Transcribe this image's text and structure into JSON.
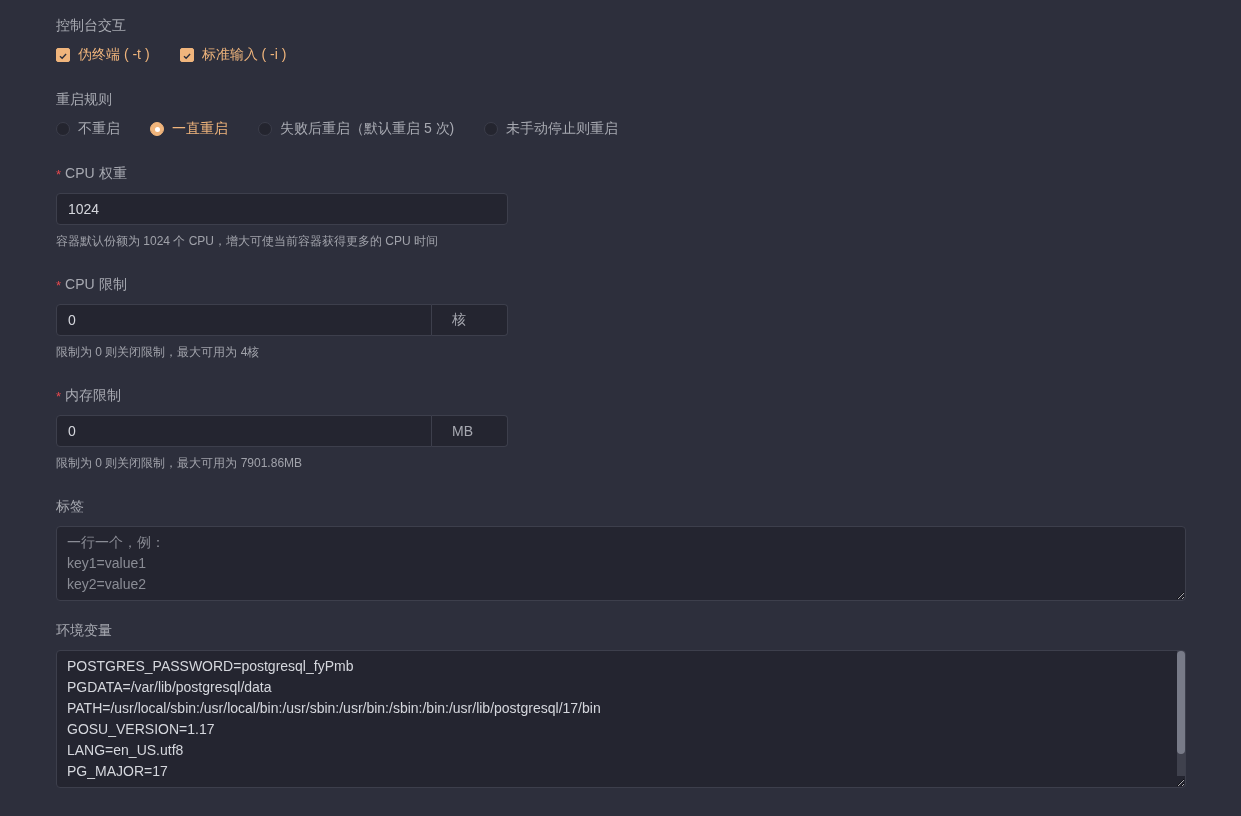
{
  "form": [
    {
      "kind": "checks",
      "label": "控制台交互",
      "options": [
        {
          "label": "伪终端 ( -t )",
          "checked": true
        },
        {
          "label": "标准输入 ( -i )",
          "checked": true
        }
      ]
    },
    {
      "kind": "radios",
      "label": "重启规则",
      "options": [
        {
          "label": "不重启",
          "selected": false
        },
        {
          "label": "一直重启",
          "selected": true
        },
        {
          "label": "失败后重启（默认重启 5 次)",
          "selected": false
        },
        {
          "label": "未手动停止则重启",
          "selected": false
        }
      ]
    },
    {
      "kind": "input",
      "required_mark": "*",
      "label": "CPU 权重",
      "value": "1024",
      "hint": "容器默认份额为 1024 个 CPU，增大可使当前容器获得更多的 CPU 时间"
    },
    {
      "kind": "input",
      "required_mark": "*",
      "label": "CPU 限制",
      "value": "0",
      "suffix": "核",
      "hint": "限制为 0 则关闭限制，最大可用为 4核"
    },
    {
      "kind": "input",
      "required_mark": "*",
      "label": "内存限制",
      "value": "0",
      "suffix": "MB",
      "hint": "限制为 0 则关闭限制，最大可用为 7901.86MB"
    },
    {
      "kind": "textarea",
      "label": "标签",
      "placeholder": "一行一个，例：\nkey1=value1\nkey2=value2"
    },
    {
      "kind": "textarea",
      "label": "环境变量",
      "value": "POSTGRES_PASSWORD=postgresql_fyPmb\nPGDATA=/var/lib/postgresql/data\nPATH=/usr/local/sbin:/usr/local/bin:/usr/sbin:/usr/bin:/sbin:/bin:/usr/lib/postgresql/17/bin\nGOSU_VERSION=1.17\nLANG=en_US.utf8\nPG_MAJOR=17"
    }
  ]
}
